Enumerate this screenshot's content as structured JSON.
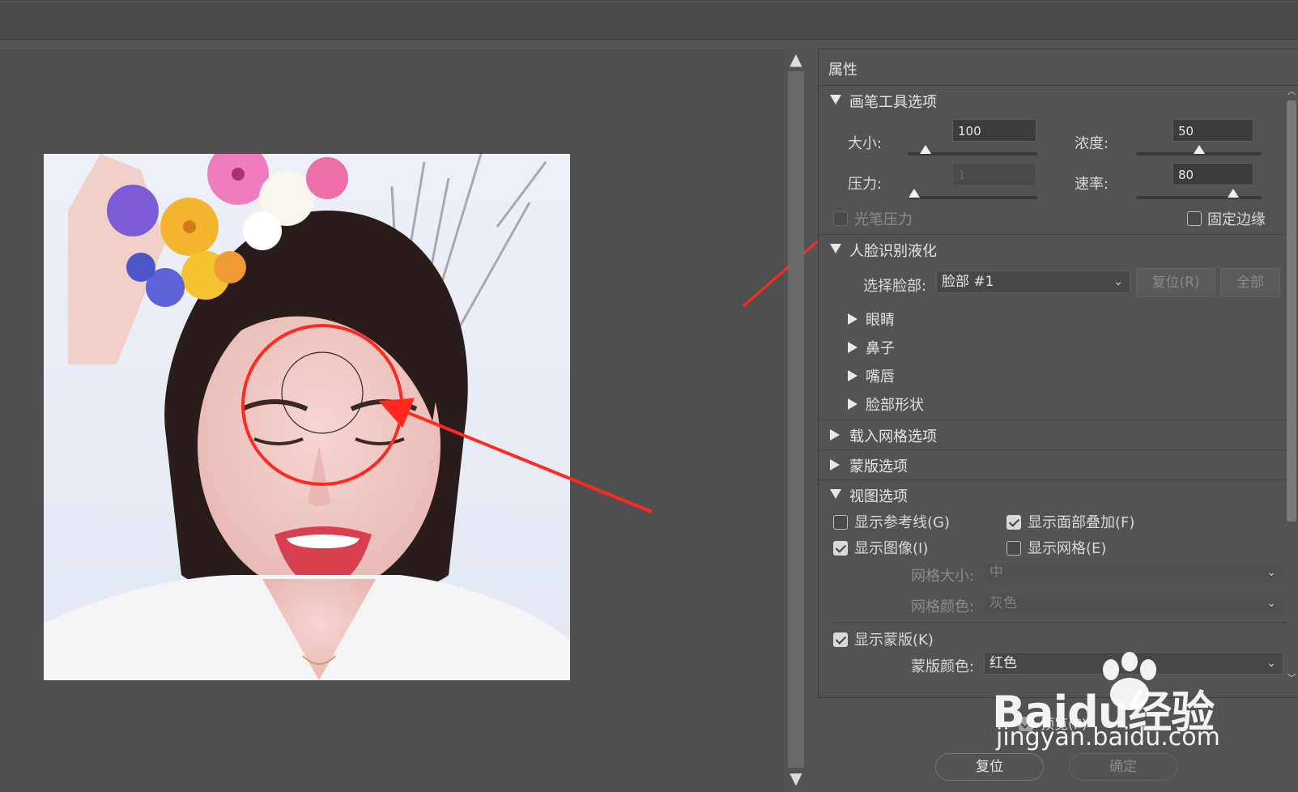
{
  "panel": {
    "title": "属性"
  },
  "brush": {
    "section_label": "画笔工具选项",
    "size_label": "大小:",
    "size_value": "100",
    "size_level": 0.1,
    "density_label": "浓度:",
    "density_value": "50",
    "density_level": 0.5,
    "pressure_label": "压力:",
    "pressure_value": "1",
    "pressure_level": 0.01,
    "rate_label": "速率:",
    "rate_value": "80",
    "rate_level": 0.8,
    "stylus_label": "光笔压力",
    "pin_edges_label": "固定边缘"
  },
  "face": {
    "section_label": "人脸识别液化",
    "select_label": "选择脸部:",
    "select_value": "脸部 #1",
    "reset_label": "复位(R)",
    "all_label": "全部",
    "items": [
      "眼睛",
      "鼻子",
      "嘴唇",
      "脸部形状"
    ]
  },
  "mesh": {
    "section_label": "载入网格选项"
  },
  "mask": {
    "section_label": "蒙版选项"
  },
  "view": {
    "section_label": "视图选项",
    "show_guides": "显示参考线(G)",
    "show_face_overlay": "显示面部叠加(F)",
    "show_image": "显示图像(I)",
    "show_mesh": "显示网格(E)",
    "mesh_size_label": "网格大小:",
    "mesh_size_value": "中",
    "mesh_color_label": "网格颜色:",
    "mesh_color_value": "灰色",
    "show_mask": "显示蒙版(K)",
    "mask_color_label": "蒙版颜色:",
    "mask_color_value": "红色"
  },
  "footer": {
    "preview_label": "预览(P)",
    "reset_button": "复位",
    "ok_button": "确定"
  },
  "watermark": {
    "logo": "Baidu经验",
    "url": "jingyan.baidu.com"
  },
  "colors": {
    "annotation": "#ff2a1f",
    "panel_bg": "#535353"
  }
}
